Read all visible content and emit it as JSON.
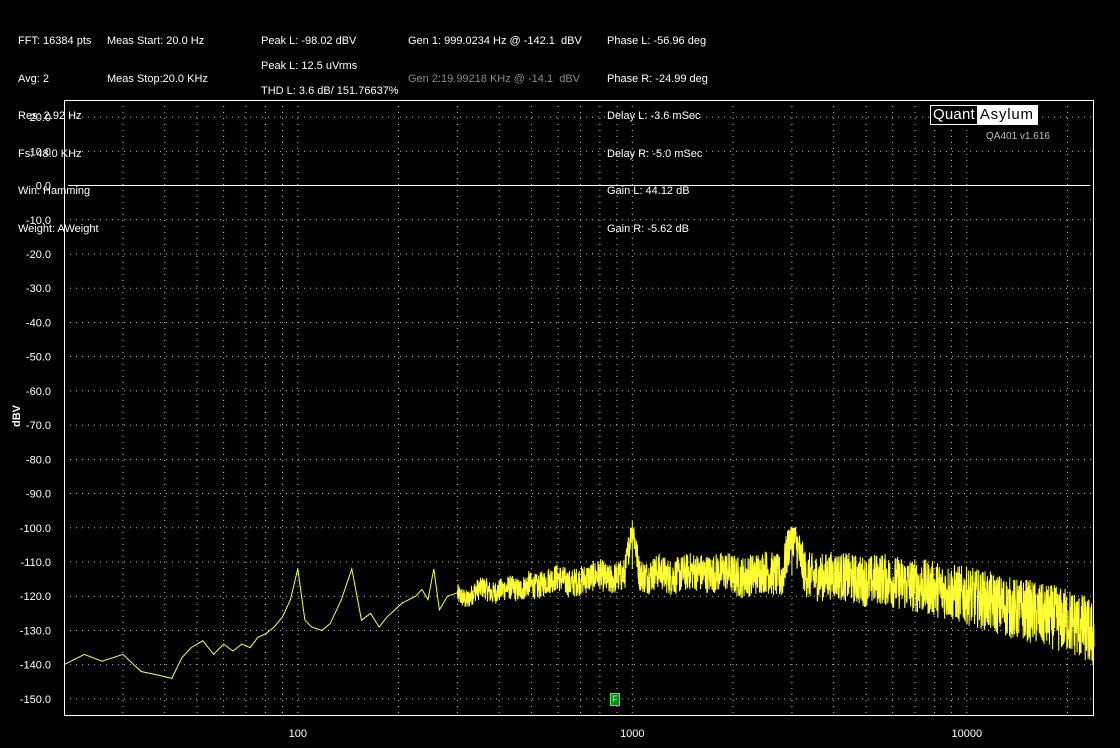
{
  "header": {
    "col1": [
      "FFT: 16384 pts",
      "Avg: 2",
      "Res: 2.92 Hz",
      "Fs: 48.0 KHz",
      "Win: Hamming",
      "Weight: AWeight"
    ],
    "col2": [
      "Meas Start: 20.0 Hz",
      "Meas Stop:20.0 KHz"
    ],
    "col3": {
      "peak_l_dbv": "Peak L: -98.02 dBV",
      "peak_l_vrms": "Peak L: 12.5 uVrms",
      "thd_l": "THD L: 3.6 dB/ 151.76637%"
    },
    "col4": {
      "gen1": "Gen 1: 999.0234 Hz @ -142.1  dBV",
      "gen2": "Gen 2:19.99218 KHz @ -14.1  dBV"
    },
    "col5": [
      "Phase L: -56.96 deg",
      "Phase R: -24.99 deg",
      "Delay L: -3.6 mSec",
      "Delay R: -5.0 mSec",
      "Gain L: 44.12 dB",
      "Gain R: -5.62 dB"
    ]
  },
  "logo": {
    "left": "Quant",
    "right": "Asylum",
    "version": "QA401 v1.616"
  },
  "marker_label": "F",
  "colors": {
    "background": "#000000",
    "trace": "#ffff33",
    "grid": "#bfbfbf",
    "ref_line": "#ffffff",
    "marker": "#0a8a2a"
  },
  "chart_data": {
    "type": "line",
    "x_scale": "log",
    "xlim": [
      20,
      24000
    ],
    "ylim": [
      -155,
      25
    ],
    "ylabel": "dBV",
    "xlabel": "",
    "yticks": [
      20,
      10,
      0,
      -10,
      -20,
      -30,
      -40,
      -50,
      -60,
      -70,
      -80,
      -90,
      -100,
      -110,
      -120,
      -130,
      -140,
      -150
    ],
    "ytick_labels": [
      "20.0",
      "10.0",
      "0.0",
      "-10.0",
      "-20.0",
      "-30.0",
      "-40.0",
      "-50.0",
      "-60.0",
      "-70.0",
      "-80.0",
      "-90.0",
      "-100.0",
      "-110.0",
      "-120.0",
      "-130.0",
      "-140.0",
      "-150.0"
    ],
    "xticks": [
      100,
      1000,
      10000
    ],
    "xtick_labels": [
      "100",
      "1000",
      "10000"
    ],
    "grid": true,
    "reference_line": {
      "y": 0
    },
    "marker": {
      "x": 1000,
      "y": -150
    },
    "series": [
      {
        "name": "",
        "x": [
          20,
          23,
          26,
          30,
          34,
          38,
          42,
          45,
          48,
          52,
          56,
          60,
          64,
          68,
          72,
          76,
          80,
          85,
          90,
          95,
          100,
          105,
          110,
          118,
          125,
          135,
          145,
          155,
          165,
          175,
          185,
          195,
          205,
          215,
          225,
          235,
          245,
          255,
          265,
          280,
          300,
          320,
          340,
          360,
          380,
          400,
          430,
          460,
          490,
          520,
          560,
          600,
          650,
          700,
          750,
          800,
          850,
          900,
          950,
          1000,
          1050,
          1100,
          1200,
          1300,
          1400,
          1500,
          1700,
          1900,
          2100,
          2300,
          2500,
          2800,
          3000,
          3300,
          3600,
          4000,
          4500,
          5000,
          5500,
          6000,
          7000,
          8000,
          9000,
          10000,
          11000,
          12000,
          13000,
          14000,
          15000,
          16000,
          17000,
          18000,
          19000,
          20000,
          21000,
          22000,
          23000,
          24000
        ],
        "y": [
          -140,
          -137,
          -139,
          -137,
          -142,
          -143,
          -144,
          -138,
          -135,
          -133,
          -137,
          -134,
          -136,
          -134,
          -135,
          -132,
          -131,
          -129,
          -126,
          -121,
          -112,
          -127,
          -129,
          -130,
          -128,
          -121,
          -112,
          -127,
          -125,
          -129,
          -126,
          -124,
          -122,
          -121,
          -120,
          -118,
          -121,
          -112,
          -124,
          -120,
          -119,
          -121,
          -118,
          -117,
          -119,
          -118,
          -117,
          -118,
          -116,
          -117,
          -115,
          -114,
          -116,
          -115,
          -114,
          -113,
          -115,
          -114,
          -113,
          -98,
          -113,
          -114,
          -112,
          -114,
          -113,
          -112,
          -113,
          -112,
          -114,
          -113,
          -112,
          -114,
          -100,
          -113,
          -114,
          -113,
          -114,
          -115,
          -114,
          -115,
          -116,
          -117,
          -118,
          -119,
          -120,
          -121,
          -122,
          -123,
          -123,
          -124,
          -125,
          -125,
          -126,
          -126,
          -127,
          -128,
          -129,
          -131
        ]
      }
    ]
  }
}
